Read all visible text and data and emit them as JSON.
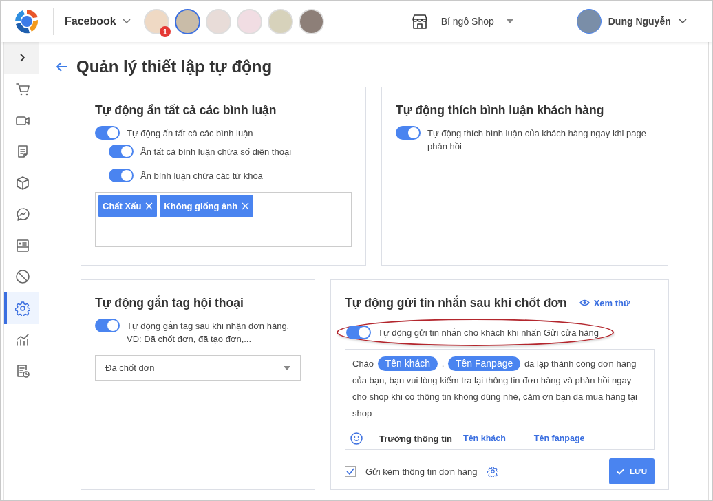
{
  "header": {
    "platform": "Facebook",
    "pages": [
      {
        "badge": "1",
        "selected": false
      },
      {
        "selected": true
      },
      {
        "selected": false
      },
      {
        "selected": false
      },
      {
        "selected": false
      },
      {
        "selected": false
      }
    ],
    "shop": "Bí ngô Shop",
    "user": "Dung Nguyễn"
  },
  "sidebar": {
    "items": [
      {
        "kind": "expand",
        "selected": false
      },
      {
        "kind": "cart",
        "selected": false
      },
      {
        "kind": "video",
        "selected": false
      },
      {
        "kind": "document",
        "selected": false
      },
      {
        "kind": "box",
        "selected": false
      },
      {
        "kind": "messenger",
        "selected": false
      },
      {
        "kind": "card",
        "selected": false
      },
      {
        "kind": "ban",
        "selected": false
      },
      {
        "kind": "gear",
        "selected": true
      },
      {
        "kind": "chart",
        "selected": false
      },
      {
        "kind": "report",
        "selected": false
      }
    ]
  },
  "page": {
    "title": "Quản lý thiết lập tự động"
  },
  "cards": [
    {
      "kind": "keywords",
      "title": "Tự động ẩn tất cả các bình luận",
      "toggles": [
        {
          "label": "Tự động ẩn tất cả các bình luận",
          "on": true,
          "children": [
            {
              "label": "Ẩn tất cả bình luận chứa số điện thoại",
              "on": true
            },
            {
              "label": "Ẩn bình luận chứa các từ khóa",
              "on": true
            }
          ]
        }
      ],
      "keywords": [
        "Chất Xấu",
        "Không giống ảnh"
      ]
    },
    {
      "kind": "simple",
      "title": "Tự động thích bình luận khách hàng",
      "toggles": [
        {
          "label": "Tự động thích bình luận của khách hàng ngay khi page phản hồi",
          "on": true
        }
      ]
    },
    {
      "kind": "tag",
      "title": "Tự động gắn tag hội thoại",
      "toggles": [
        {
          "label": "Tự động gắn tag sau khi nhận đơn hàng. VD: Đã chốt đơn, đã tạo đơn,...",
          "on": true
        }
      ],
      "dropdown": {
        "value": "Đã chốt đơn"
      }
    },
    {
      "kind": "message",
      "title": "Tự động gửi tin nhắn sau khi chốt đơn",
      "preview_link": "Xem thử",
      "toggles": [
        {
          "label": "Tự động gửi tin nhắn cho khách khi nhấn Gửi cửa hàng",
          "on": true,
          "highlighted": true
        }
      ],
      "message": [
        {
          "kind": "text",
          "text": "Chào"
        },
        {
          "kind": "chip",
          "text": "Tên khách"
        },
        {
          "kind": "text",
          "text": ","
        },
        {
          "kind": "chip",
          "text": "Tên Fanpage"
        },
        {
          "kind": "text",
          "text": "đã lập thành công đơn hàng của bạn, bạn vui lòng kiểm tra lại thông tin đơn hàng và phản hồi ngay cho shop khi có thông tin không đúng nhé, cảm ơn bạn đã mua hàng tại shop"
        }
      ],
      "field_bar": {
        "label": "Trường thông tin",
        "links": [
          "Tên khách",
          "Tên fanpage"
        ]
      },
      "attach": {
        "label": "Gửi kèm thông tin đơn hàng",
        "checked": true
      },
      "save_button": "LƯU"
    }
  ]
}
